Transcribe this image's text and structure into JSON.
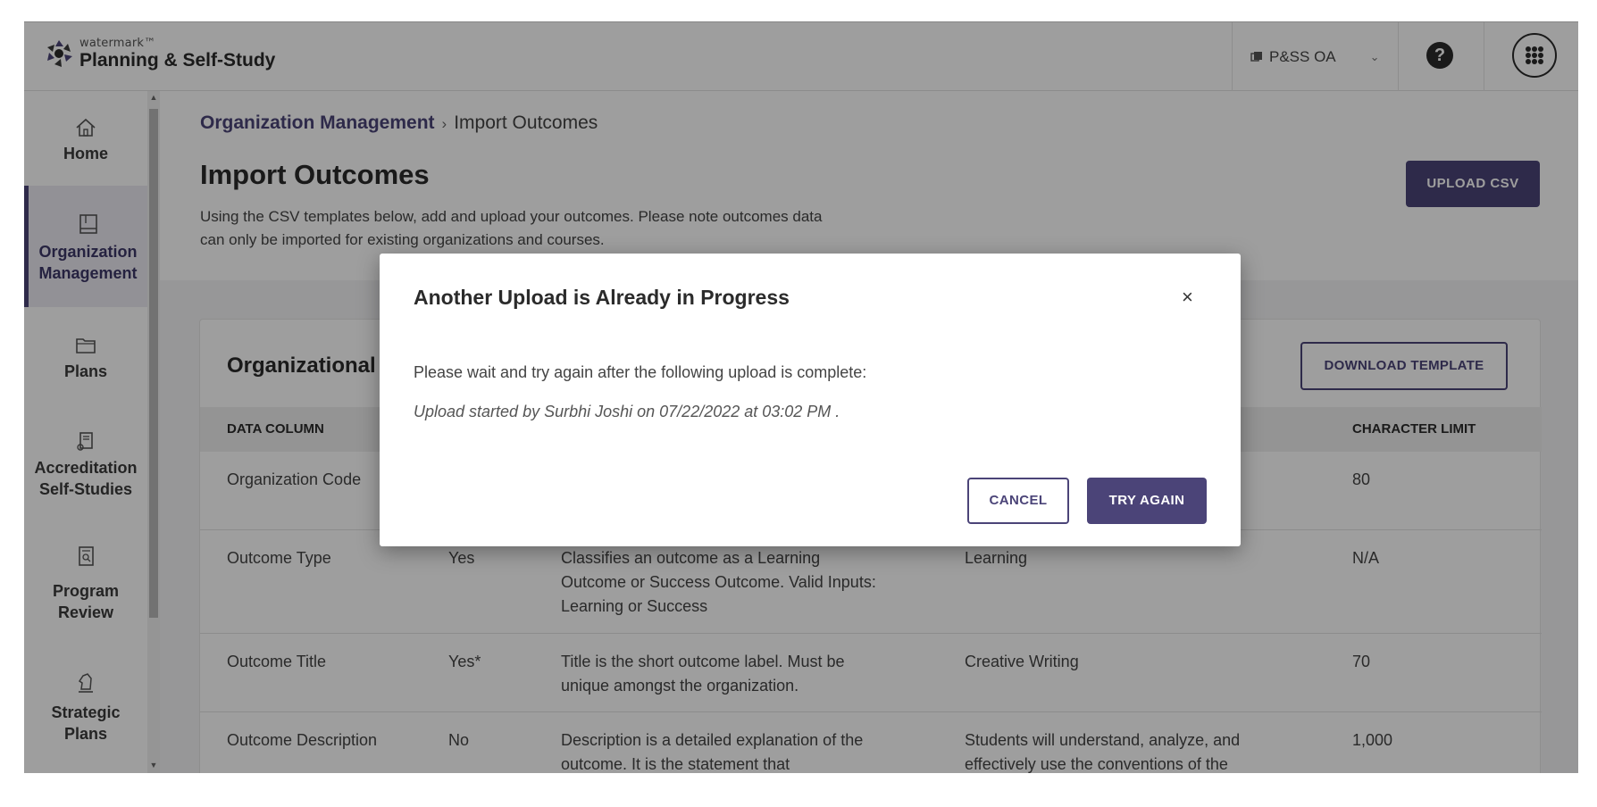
{
  "header": {
    "brand_small": "watermark™",
    "brand_name": "Planning & Self-Study",
    "org_selector": "P&SS OA",
    "help_label": "?"
  },
  "sidebar": {
    "items": [
      {
        "label_line1": "Home",
        "label_line2": "",
        "icon": "home-icon"
      },
      {
        "label_line1": "Organization",
        "label_line2": "Management",
        "icon": "book-icon",
        "active": true
      },
      {
        "label_line1": "Plans",
        "label_line2": "",
        "icon": "folder-icon"
      },
      {
        "label_line1": "Accreditation",
        "label_line2": "Self-Studies",
        "icon": "certificate-icon"
      },
      {
        "label_line1": "Program",
        "label_line2": "Review",
        "icon": "document-search-icon"
      },
      {
        "label_line1": "Strategic",
        "label_line2": "Plans",
        "icon": "chess-knight-icon"
      }
    ]
  },
  "breadcrumb": {
    "parent": "Organization Management",
    "separator": "›",
    "current": "Import Outcomes"
  },
  "page": {
    "title": "Import Outcomes",
    "description": "Using the CSV templates below, add and upload your outcomes. Please note outcomes data can only be imported for existing organizations and courses.",
    "upload_button": "UPLOAD CSV"
  },
  "card": {
    "title": "Organizational",
    "download_button": "DOWNLOAD TEMPLATE",
    "columns": [
      "DATA COLUMN",
      "",
      "",
      "",
      "CHARACTER LIMIT"
    ],
    "rows": [
      {
        "column": "Organization Code",
        "required": "",
        "description": "",
        "example": "",
        "limit": "80"
      },
      {
        "column": "Outcome Type",
        "required": "Yes",
        "description": "Classifies an outcome as a Learning Outcome or Success Outcome. Valid Inputs: Learning or Success",
        "example": "Learning",
        "limit": "N/A"
      },
      {
        "column": "Outcome Title",
        "required": "Yes*",
        "description": "Title is the short outcome label. Must be unique amongst the organization.",
        "example": "Creative Writing",
        "limit": "70"
      },
      {
        "column": "Outcome Description",
        "required": "No",
        "description": "Description is a detailed explanation of the outcome. It is the statement that",
        "example": "Students will understand, analyze, and effectively use the conventions of the",
        "limit": "1,000"
      }
    ]
  },
  "dialog": {
    "title": "Another Upload is Already in Progress",
    "close": "×",
    "message": "Please wait and try again after the following upload is complete:",
    "detail": "Upload started by Surbhi Joshi on 07/22/2022 at 03:02 PM .",
    "cancel_button": "CANCEL",
    "try_again_button": "TRY AGAIN"
  },
  "colors": {
    "accent": "#4b4478",
    "overlay": "rgba(0,0,0,0.38)"
  }
}
